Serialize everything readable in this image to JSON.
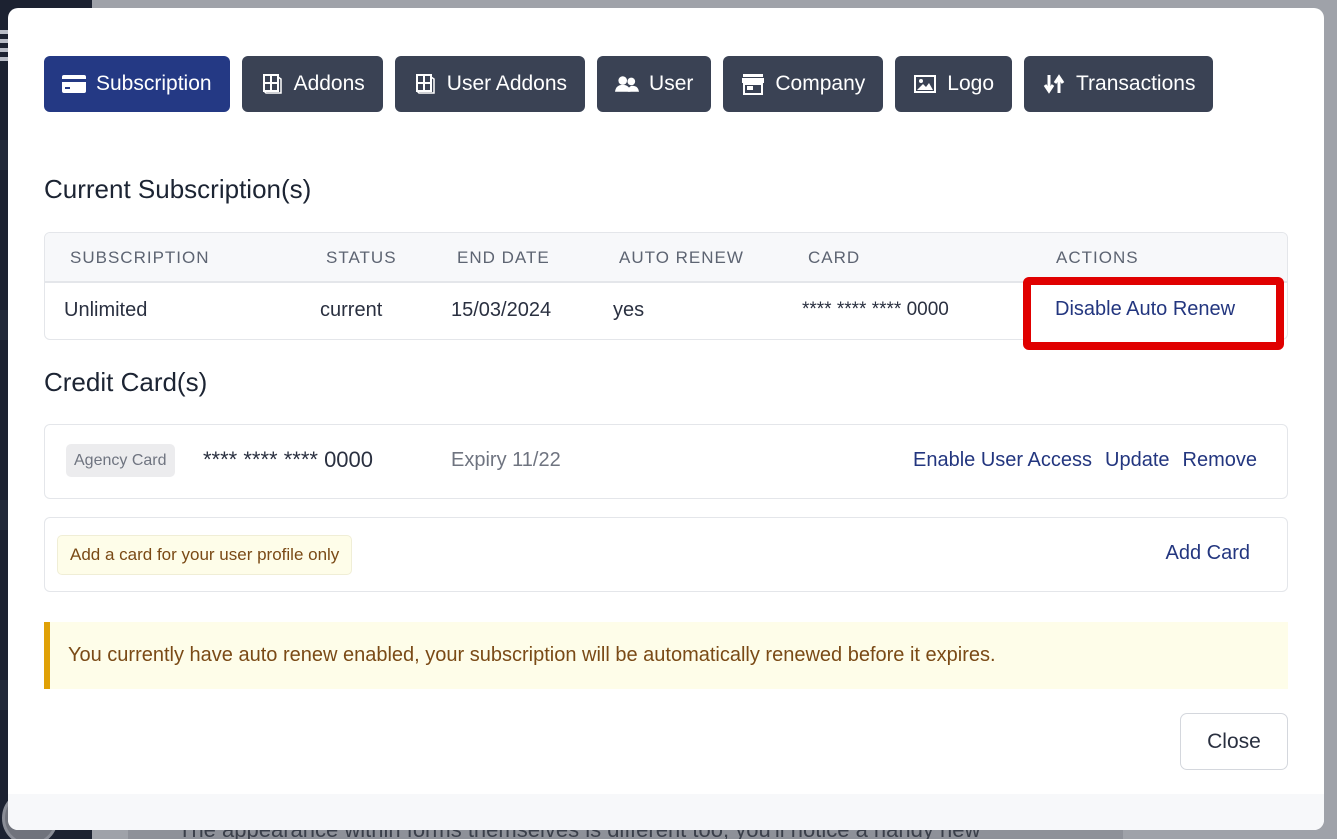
{
  "background": {
    "partial_text": "The appearance within forms themselves is different too, you'll notice a handy new"
  },
  "tabs": [
    {
      "label": "Subscription",
      "icon": "credit-card-icon",
      "active": true
    },
    {
      "label": "Addons",
      "icon": "cubes-icon",
      "active": false
    },
    {
      "label": "User Addons",
      "icon": "cubes-icon",
      "active": false
    },
    {
      "label": "User",
      "icon": "users-icon",
      "active": false
    },
    {
      "label": "Company",
      "icon": "store-icon",
      "active": false
    },
    {
      "label": "Logo",
      "icon": "image-icon",
      "active": false
    },
    {
      "label": "Transactions",
      "icon": "sort-arrows-icon",
      "active": false
    }
  ],
  "subscriptions": {
    "title": "Current Subscription(s)",
    "columns": [
      "SUBSCRIPTION",
      "STATUS",
      "END DATE",
      "AUTO RENEW",
      "CARD",
      "ACTIONS"
    ],
    "rows": [
      {
        "subscription": "Unlimited",
        "status": "current",
        "end_date": "15/03/2024",
        "auto_renew": "yes",
        "card": "**** **** **** 0000",
        "action": "Disable Auto Renew"
      }
    ]
  },
  "credit_cards": {
    "title": "Credit Card(s)",
    "cards": [
      {
        "badge": "Agency Card",
        "number": "**** **** **** 0000",
        "expiry": "Expiry 11/22",
        "actions": [
          "Enable User Access",
          "Update",
          "Remove"
        ]
      }
    ],
    "user_note": "Add a card for your user profile only",
    "add_card_label": "Add Card"
  },
  "alert": {
    "message": "You currently have auto renew enabled, your subscription will be automatically renewed before it expires."
  },
  "footer": {
    "close_label": "Close"
  },
  "colors": {
    "active_tab": "#243984",
    "tab": "#3a4254",
    "link": "#23367f",
    "highlight": "#e00000",
    "alert_border": "#e0a106",
    "alert_bg": "#fefde9"
  }
}
